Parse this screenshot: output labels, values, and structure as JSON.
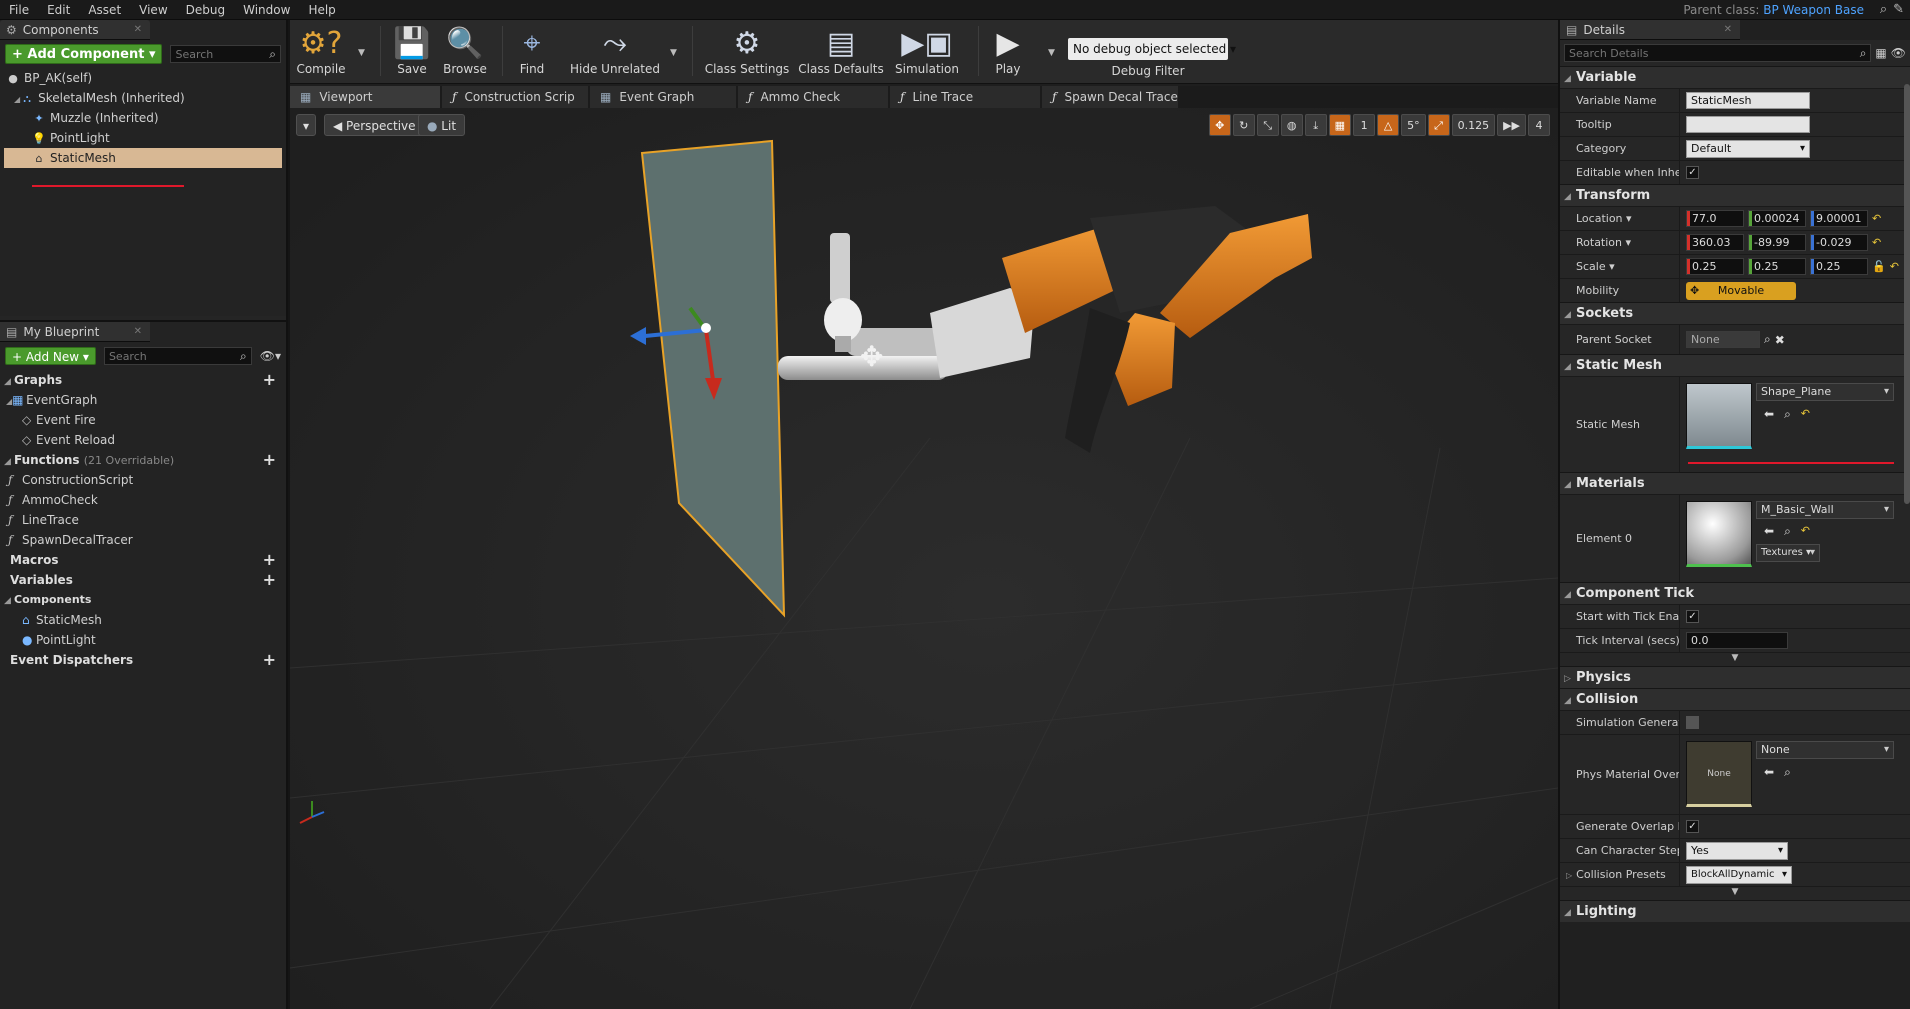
{
  "menu": [
    "File",
    "Edit",
    "Asset",
    "View",
    "Debug",
    "Window",
    "Help"
  ],
  "parent_class": {
    "label": "Parent class:",
    "value": "BP Weapon Base"
  },
  "components": {
    "tab": "Components",
    "add_button": "+ Add Component ▾",
    "search_placeholder": "Search",
    "root": "BP_AK(self)",
    "items": [
      {
        "label": "SkeletalMesh (Inherited)"
      },
      {
        "label": "Muzzle (Inherited)"
      },
      {
        "label": "PointLight"
      },
      {
        "label": "StaticMesh"
      }
    ]
  },
  "my_blueprint": {
    "tab": "My Blueprint",
    "add_new": "+ Add New ▾",
    "search_placeholder": "Search",
    "graphs_label": "Graphs",
    "event_graph": "EventGraph",
    "events": [
      "Event Fire",
      "Event Reload"
    ],
    "functions_label": "Functions",
    "functions_sub": "(21 Overridable)",
    "functions": [
      "ConstructionScript",
      "AmmoCheck",
      "LineTrace",
      "SpawnDecalTracer"
    ],
    "macros_label": "Macros",
    "variables_label": "Variables",
    "components_label": "Components",
    "component_vars": [
      "StaticMesh",
      "PointLight"
    ],
    "dispatchers_label": "Event Dispatchers"
  },
  "toolbar": {
    "compile": "Compile",
    "save": "Save",
    "browse": "Browse",
    "find": "Find",
    "hide_unrelated": "Hide Unrelated",
    "class_settings": "Class Settings",
    "class_defaults": "Class Defaults",
    "simulation": "Simulation",
    "play": "Play",
    "debug_object": "No debug object selected ▾",
    "debug_filter": "Debug Filter"
  },
  "doc_tabs": [
    {
      "label": "Viewport",
      "fn": false
    },
    {
      "label": "Construction Scrip",
      "fn": true
    },
    {
      "label": "Event Graph",
      "fn": false
    },
    {
      "label": "Ammo Check",
      "fn": true
    },
    {
      "label": "Line Trace",
      "fn": true
    },
    {
      "label": "Spawn Decal Trace",
      "fn": true
    }
  ],
  "viewport": {
    "perspective": "Perspective",
    "lit": "Lit",
    "grid_snap": "1",
    "rot_snap": "5°",
    "scale_snap": "0.125",
    "cam_speed": "4"
  },
  "details": {
    "tab": "Details",
    "search_placeholder": "Search Details",
    "variable_section": "Variable",
    "variable_name_label": "Variable Name",
    "variable_name": "StaticMesh",
    "tooltip_label": "Tooltip",
    "category_label": "Category",
    "category": "Default",
    "editable_label": "Editable when Inherit",
    "transform_section": "Transform",
    "location_label": "Location ▾",
    "location": [
      "77.0",
      "0.00024",
      "9.00001"
    ],
    "rotation_label": "Rotation ▾",
    "rotation": [
      "360.03",
      "-89.99",
      "-0.029"
    ],
    "scale_label": "Scale ▾",
    "scale": [
      "0.25",
      "0.25",
      "0.25"
    ],
    "mobility_label": "Mobility",
    "mobility": "Movable",
    "sockets_section": "Sockets",
    "parent_socket_label": "Parent Socket",
    "parent_socket": "None",
    "static_mesh_section": "Static Mesh",
    "static_mesh_label": "Static Mesh",
    "static_mesh": "Shape_Plane",
    "materials_section": "Materials",
    "element0_label": "Element 0",
    "material": "M_Basic_Wall",
    "textures": "Textures ▾",
    "tick_section": "Component Tick",
    "start_tick_label": "Start with Tick Enabl",
    "tick_interval_label": "Tick Interval (secs)",
    "tick_interval": "0.0",
    "physics_section": "Physics",
    "collision_section": "Collision",
    "sim_generate_label": "Simulation Generate",
    "phys_material_label": "Phys Material Overri",
    "phys_material": "None",
    "phys_thumb": "None",
    "overlap_label": "Generate Overlap Ev",
    "step_label": "Can Character Step U",
    "step_value": "Yes",
    "presets_label": "Collision Presets",
    "presets_value": "BlockAllDynamic",
    "lighting_section": "Lighting"
  }
}
